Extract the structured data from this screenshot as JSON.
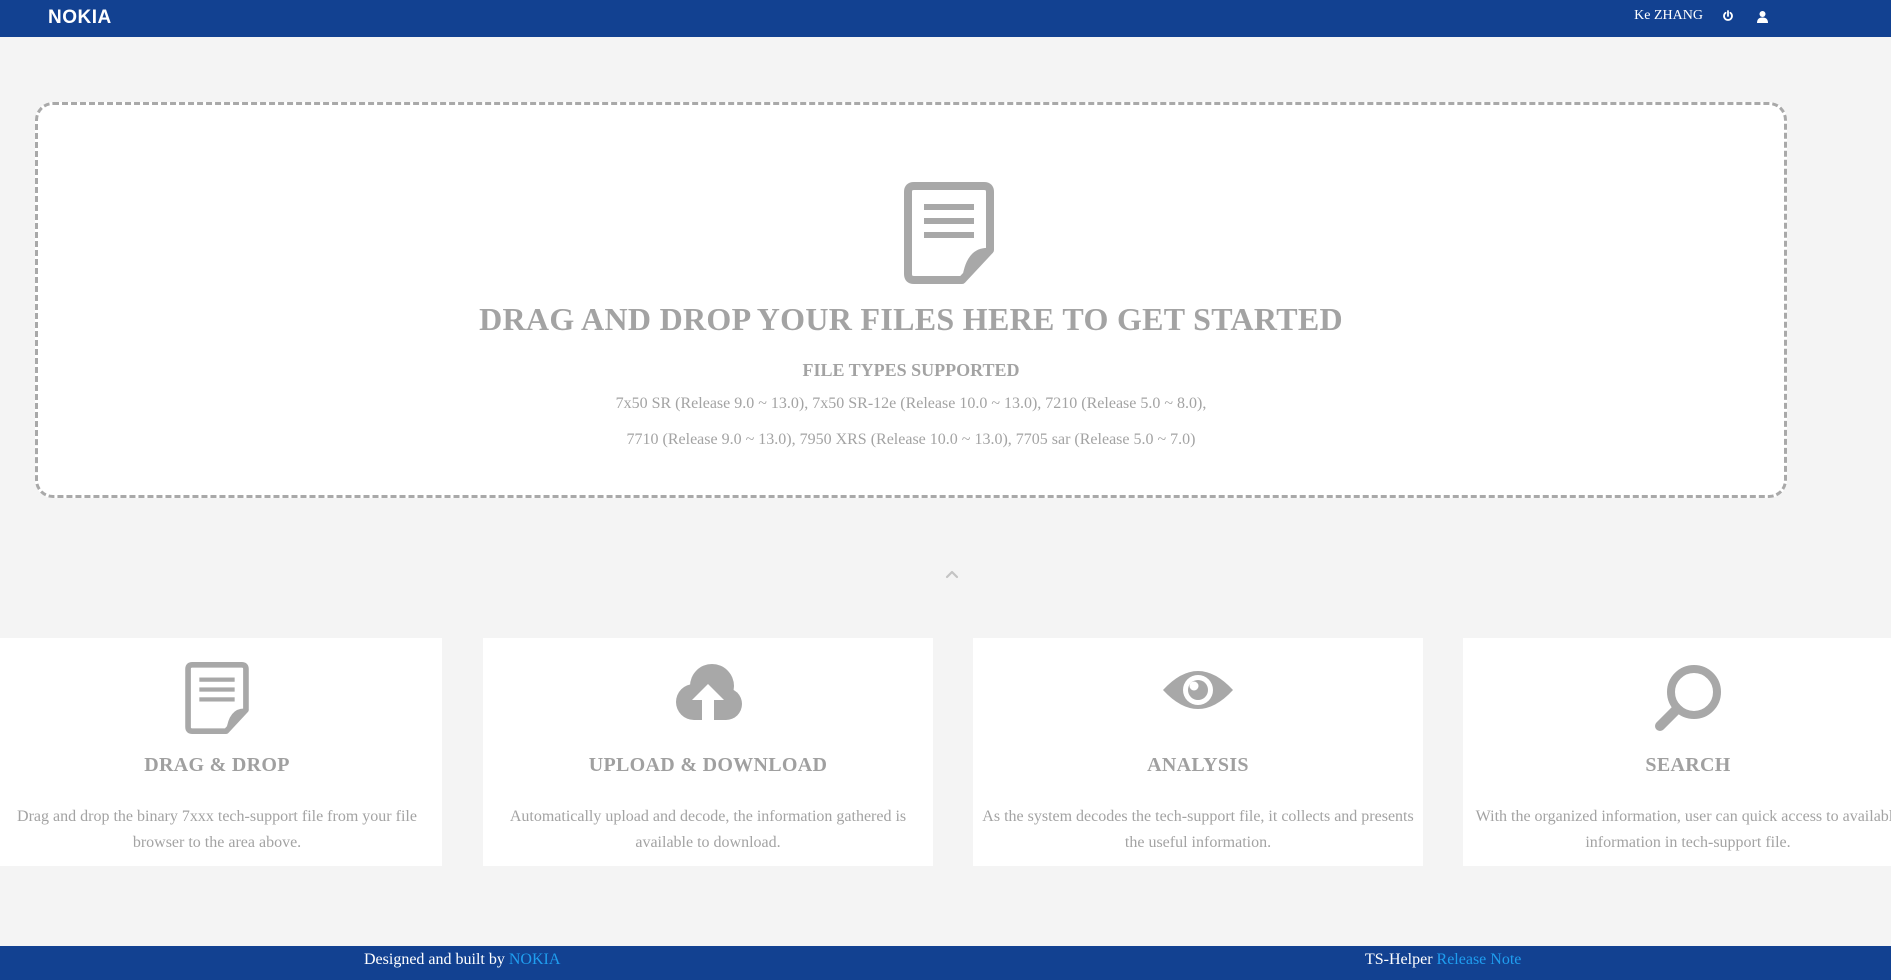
{
  "header": {
    "logo": "NOKIA",
    "username": "Ke ZHANG",
    "icons": [
      "power-icon",
      "user-icon"
    ]
  },
  "dropzone": {
    "icon": "document-icon",
    "title": "DRAG AND DROP YOUR FILES HERE TO GET STARTED",
    "subtitle": "FILE TYPES SUPPORTED",
    "supported_line1": "7x50 SR (Release 9.0 ~ 13.0), 7x50 SR-12e (Release 10.0 ~ 13.0), 7210 (Release 5.0 ~ 8.0),",
    "supported_line2": "7710 (Release 9.0 ~ 13.0), 7950 XRS (Release 10.0 ~ 13.0), 7705 sar (Release 5.0 ~ 7.0)"
  },
  "features": [
    {
      "icon": "document-icon",
      "title": "DRAG & DROP",
      "desc1": "Drag and drop the binary 7xxx tech-support file from your file",
      "desc2": "browser to the area above."
    },
    {
      "icon": "cloud-upload-icon",
      "title": "UPLOAD & DOWNLOAD",
      "desc1": "Automatically upload and decode, the information gathered is",
      "desc2": "available to download."
    },
    {
      "icon": "eye-icon",
      "title": "ANALYSIS",
      "desc1": "As the system decodes the tech-support file, it collects and presents",
      "desc2": "the useful information."
    },
    {
      "icon": "search-icon",
      "title": "SEARCH",
      "desc1": "With the organized information, user can quick access to available",
      "desc2": "information in tech-support file."
    }
  ],
  "footer": {
    "designed_by": "Designed and built by",
    "brand_link": "NOKIA",
    "app_name": "TS-Helper",
    "release_link": "Release Note"
  },
  "colors": {
    "brand_blue": "#124191",
    "link_blue": "#1f9ef0",
    "icon_gray": "#a8a8a8",
    "background": "#f4f4f4"
  }
}
